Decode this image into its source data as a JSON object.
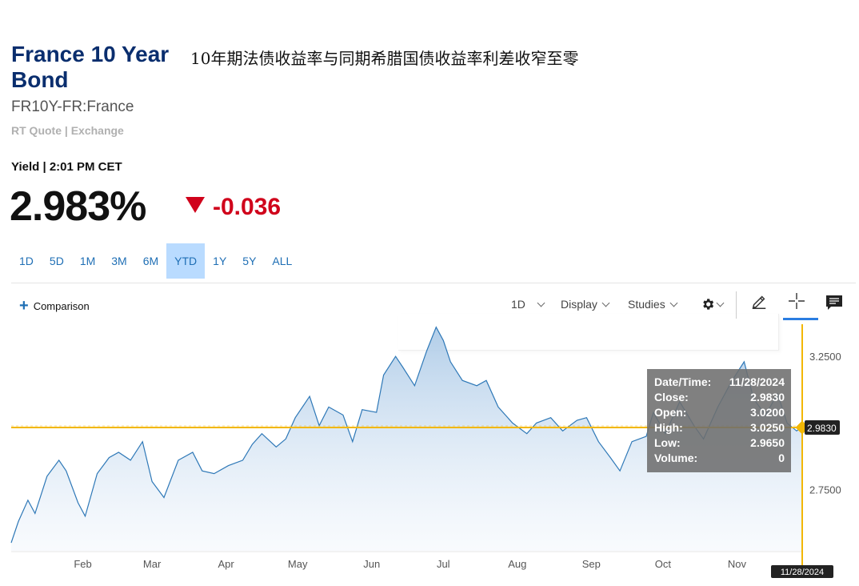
{
  "header": {
    "title": "France 10 Year Bond",
    "headline": "10年期法债收益率与同期希腊国债收益率利差收窄至零",
    "symbol": "FR10Y-FR:France",
    "quote_source": "RT Quote | Exchange",
    "yield_label": "Yield | 2:01 PM CET",
    "price": "2.983%",
    "change": "-0.036",
    "change_color": "#d0021b"
  },
  "ranges": [
    "1D",
    "5D",
    "1M",
    "3M",
    "6M",
    "YTD",
    "1Y",
    "5Y",
    "ALL"
  ],
  "active_range": "YTD",
  "toolbar": {
    "comparison_label": "Comparison",
    "interval_label": "1D",
    "display_label": "Display",
    "studies_label": "Studies"
  },
  "icons": [
    "plus-icon",
    "gear-icon",
    "pencil-icon",
    "crosshair-icon",
    "chat-icon"
  ],
  "tooltip": {
    "datetime_label": "Date/Time:",
    "datetime": "11/28/2024",
    "close_label": "Close:",
    "close": "2.9830",
    "open_label": "Open:",
    "open": "3.0200",
    "high_label": "High:",
    "high": "3.0250",
    "low_label": "Low:",
    "low": "2.9650",
    "volume_label": "Volume:",
    "volume": "0"
  },
  "chart_data": {
    "type": "area",
    "title": "",
    "xlabel": "",
    "ylabel": "",
    "x_tick_labels": [
      "Feb",
      "Mar",
      "Apr",
      "May",
      "Jun",
      "Jul",
      "Aug",
      "Sep",
      "Oct",
      "Nov"
    ],
    "y_tick_labels": [
      "3.2500",
      "2.7500"
    ],
    "y_ticks": [
      3.25,
      2.75
    ],
    "ylim": [
      2.52,
      3.38
    ],
    "xlim": [
      "2024-01-02",
      "2024-11-28"
    ],
    "grid": false,
    "line_color": "#2e78b7",
    "fill_color": "#c9ddf0",
    "crosshair_color": "#f2b705",
    "last_value": 2.983,
    "last_value_label": "2.9830",
    "cursor_date_label": "11/28/2024",
    "series": [
      {
        "x": [
          "2024-01-02",
          "2024-01-05",
          "2024-01-09",
          "2024-01-12",
          "2024-01-17",
          "2024-01-22",
          "2024-01-25",
          "2024-01-30",
          "2024-02-02",
          "2024-02-07",
          "2024-02-12",
          "2024-02-16",
          "2024-02-21",
          "2024-02-26",
          "2024-03-01",
          "2024-03-06",
          "2024-03-12",
          "2024-03-18",
          "2024-03-22",
          "2024-03-27",
          "2024-04-02",
          "2024-04-08",
          "2024-04-12",
          "2024-04-16",
          "2024-04-22",
          "2024-04-26",
          "2024-04-30",
          "2024-05-06",
          "2024-05-10",
          "2024-05-14",
          "2024-05-20",
          "2024-05-24",
          "2024-05-28",
          "2024-06-03",
          "2024-06-06",
          "2024-06-11",
          "2024-06-14",
          "2024-06-19",
          "2024-06-24",
          "2024-06-28",
          "2024-07-01",
          "2024-07-04",
          "2024-07-09",
          "2024-07-15",
          "2024-07-19",
          "2024-07-24",
          "2024-07-30",
          "2024-08-05",
          "2024-08-09",
          "2024-08-15",
          "2024-08-20",
          "2024-08-26",
          "2024-08-30",
          "2024-09-04",
          "2024-09-09",
          "2024-09-13",
          "2024-09-18",
          "2024-09-24",
          "2024-09-27",
          "2024-10-02",
          "2024-10-08",
          "2024-10-14",
          "2024-10-18",
          "2024-10-24",
          "2024-10-30",
          "2024-11-04",
          "2024-11-08",
          "2024-11-13",
          "2024-11-18",
          "2024-11-22",
          "2024-11-26",
          "2024-11-28"
        ],
        "y": [
          2.55,
          2.63,
          2.71,
          2.66,
          2.8,
          2.86,
          2.82,
          2.7,
          2.65,
          2.81,
          2.87,
          2.89,
          2.86,
          2.93,
          2.78,
          2.72,
          2.86,
          2.89,
          2.82,
          2.81,
          2.84,
          2.86,
          2.92,
          2.96,
          2.91,
          2.94,
          3.02,
          3.1,
          2.99,
          3.06,
          3.03,
          2.93,
          3.05,
          3.04,
          3.18,
          3.25,
          3.21,
          3.14,
          3.27,
          3.36,
          3.31,
          3.23,
          3.16,
          3.14,
          3.16,
          3.06,
          3.0,
          2.96,
          3.0,
          3.02,
          2.97,
          3.01,
          3.02,
          2.93,
          2.87,
          2.82,
          2.93,
          2.95,
          3.04,
          2.96,
          3.08,
          2.99,
          2.94,
          3.06,
          3.16,
          3.23,
          3.09,
          3.03,
          3.11,
          3.0,
          2.97,
          2.983
        ]
      }
    ]
  }
}
